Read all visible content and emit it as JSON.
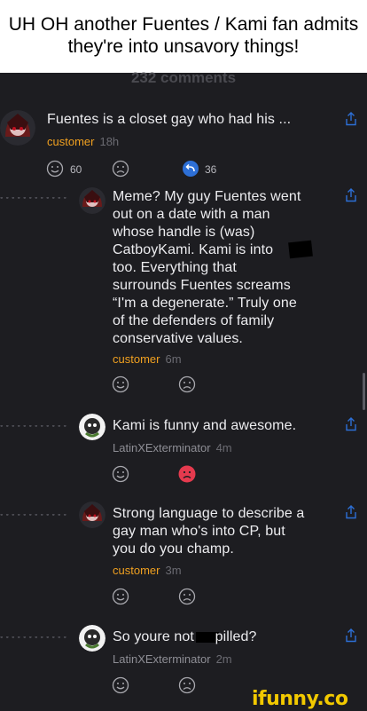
{
  "caption": "UH OH another Fuentes / Kami fan admits they're into unsavory things!",
  "comments_header": "232 comments",
  "comments": [
    {
      "text": "Fuentes is a closet gay who had his ...",
      "author": "customer",
      "time": "18h",
      "likes": "60",
      "replies": "36"
    },
    {
      "text": "Meme? My guy Fuentes went out on a date with a man whose handle is (was) CatboyKami. Kami is into too. Everything that surrounds Fuentes screams “I'm a degenerate.” Truly one of the defenders of family conservative values.",
      "lines": [
        "Meme? My guy Fuentes went",
        "out on a date with a man",
        "whose handle is (was)",
        "CatboyKami. Kami is into",
        "too. Everything that",
        "surrounds Fuentes screams",
        "“I'm a degenerate.” Truly one",
        "of the defenders of family",
        "conservative values."
      ],
      "author": "customer",
      "time": "6m"
    },
    {
      "text": "Kami is funny and awesome.",
      "author": "LatinXExterminator",
      "time": "4m"
    },
    {
      "lines": [
        "Strong language to describe a",
        "gay man who's into CP, but",
        "you do you champ."
      ],
      "author": "customer",
      "time": "3m"
    },
    {
      "text_before": "So youre not cu",
      "text_after": "pilled?",
      "author": "LatinXExterminator",
      "time": "2m"
    }
  ],
  "watermark": "ifunny.co",
  "colors": {
    "background": "#1d1d21",
    "accent_author": "#f0a020",
    "reply_blue": "#2d6fd6",
    "dislike_red": "#e53a4e"
  },
  "icons": [
    "share-icon",
    "smile-icon",
    "frown-icon",
    "reply-icon"
  ]
}
